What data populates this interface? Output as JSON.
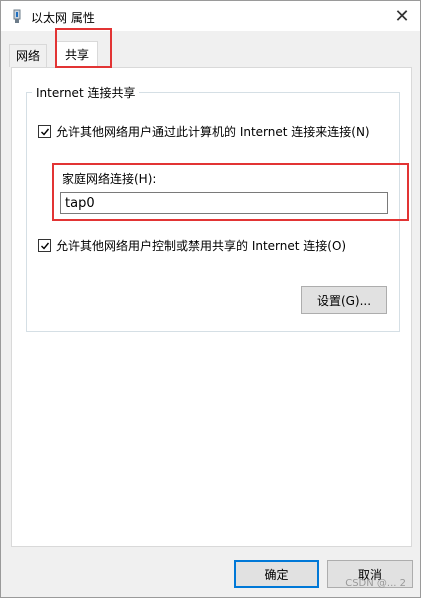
{
  "window": {
    "title": "以太网 属性",
    "close_glyph": "✕"
  },
  "tabs": [
    {
      "label": "网络"
    },
    {
      "label": "共享"
    }
  ],
  "sharing": {
    "group_title": "Internet 连接共享",
    "allow_connect_label": "允许其他网络用户通过此计算机的 Internet 连接来连接(N)",
    "allow_connect_checked": true,
    "home_network_label": "家庭网络连接(H):",
    "home_network_value": "tap0",
    "allow_control_label": "允许其他网络用户控制或禁用共享的 Internet 连接(O)",
    "allow_control_checked": true,
    "settings_button": "设置(G)..."
  },
  "footer": {
    "ok_button": "确定",
    "cancel_button": "取消",
    "watermark": "CSDN @... 2"
  },
  "colors": {
    "highlight": "#e23434",
    "ok_border": "#0078d7"
  }
}
